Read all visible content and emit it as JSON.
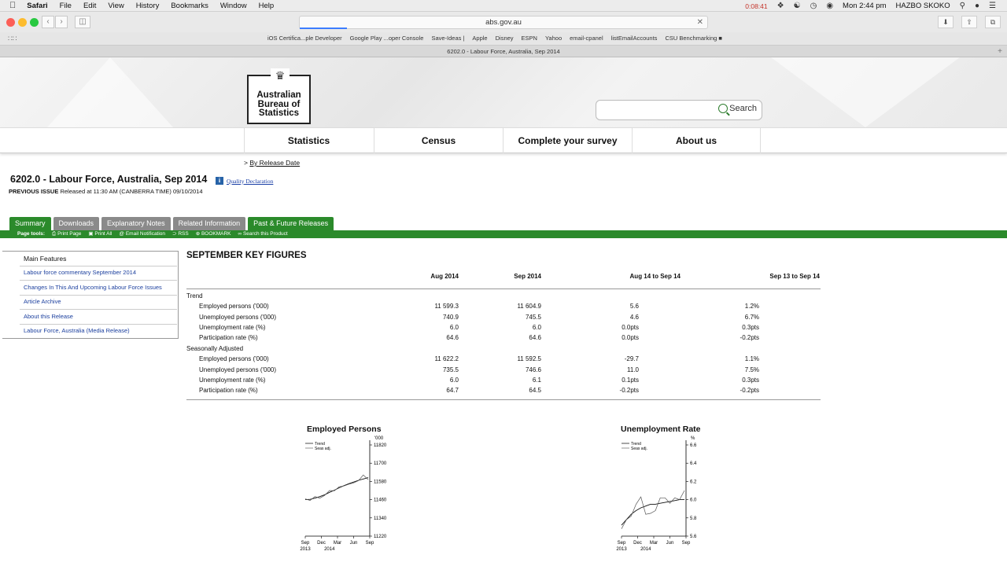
{
  "menubar": {
    "app": "Safari",
    "items": [
      "File",
      "Edit",
      "View",
      "History",
      "Bookmarks",
      "Window",
      "Help"
    ],
    "recording_time": "0:08:41",
    "clock": "Mon 2:44 pm",
    "user": "HAZBO SKOKO"
  },
  "toolbar": {
    "address": "abs.gov.au"
  },
  "favorites": [
    "iOS Certifica...ple Developer",
    "Google Play ...oper Console",
    "Save-Ideas |",
    "Apple",
    "Disney",
    "ESPN",
    "Yahoo",
    "email-cpanel",
    "listEmailAccounts",
    "CSU Benchmarking ■"
  ],
  "tab_title": "6202.0 - Labour Force, Australia, Sep 2014",
  "header": {
    "logo_text": "Australian\nBureau of\nStatistics",
    "search_label": "Search"
  },
  "nav": [
    "Statistics",
    "Census",
    "Complete your survey",
    "About us"
  ],
  "breadcrumb": {
    "prefix": ">",
    "link": "By Release Date"
  },
  "page": {
    "title": "6202.0 - Labour Force, Australia, Sep 2014",
    "quality_link": "Quality Declaration",
    "prev_label": "PREVIOUS ISSUE",
    "prev_text": "Released at 11:30 AM (CANBERRA TIME) 09/10/2014"
  },
  "tabs": [
    "Summary",
    "Downloads",
    "Explanatory Notes",
    "Related Information",
    "Past & Future Releases"
  ],
  "page_tools": {
    "label": "Page tools:",
    "items": [
      "Print Page",
      "Print All",
      "Email Notification",
      "RSS",
      "BOOKMARK",
      "Search this Product"
    ]
  },
  "sidebar": {
    "heading": "Main Features",
    "links": [
      "Labour force commentary September 2014",
      "Changes In This And Upcoming Labour Force Issues",
      "Article Archive",
      "About this Release",
      "Labour Force, Australia (Media Release)"
    ]
  },
  "key_figures": {
    "title": "SEPTEMBER KEY FIGURES",
    "headers": [
      "Aug 2014",
      "Sep 2014",
      "Aug 14 to Sep 14",
      "Sep 13 to Sep 14"
    ],
    "groups": [
      {
        "name": "Trend",
        "rows": [
          {
            "label": "Employed persons ('000)",
            "v": [
              "11 599.3",
              "11 604.9",
              "5.6",
              "1.2%"
            ]
          },
          {
            "label": "Unemployed persons ('000)",
            "v": [
              "740.9",
              "745.5",
              "4.6",
              "6.7%"
            ]
          },
          {
            "label": "Unemployment rate (%)",
            "v": [
              "6.0",
              "6.0",
              "0.0pts",
              "0.3pts"
            ]
          },
          {
            "label": "Participation rate (%)",
            "v": [
              "64.6",
              "64.6",
              "0.0pts",
              "-0.2pts"
            ]
          }
        ]
      },
      {
        "name": "Seasonally Adjusted",
        "rows": [
          {
            "label": "Employed persons ('000)",
            "v": [
              "11 622.2",
              "11 592.5",
              "-29.7",
              "1.1%"
            ]
          },
          {
            "label": "Unemployed persons ('000)",
            "v": [
              "735.5",
              "746.6",
              "11.0",
              "7.5%"
            ]
          },
          {
            "label": "Unemployment rate (%)",
            "v": [
              "6.0",
              "6.1",
              "0.1pts",
              "0.3pts"
            ]
          },
          {
            "label": "Participation rate (%)",
            "v": [
              "64.7",
              "64.5",
              "-0.2pts",
              "-0.2pts"
            ]
          }
        ]
      }
    ]
  },
  "chart_data": [
    {
      "type": "line",
      "title": "Employed Persons",
      "ylabel": "'000",
      "legend": [
        "Trend",
        "Seas adj."
      ],
      "x_ticks": [
        "Sep",
        "Dec",
        "Mar",
        "Jun",
        "Sep"
      ],
      "x_years": [
        "2013",
        "2014"
      ],
      "y_ticks": [
        11220,
        11340,
        11460,
        11580,
        11700,
        11820
      ],
      "ylim": [
        11220,
        11820
      ],
      "series": [
        {
          "name": "Trend",
          "values": [
            11460,
            11462,
            11470,
            11480,
            11492,
            11508,
            11522,
            11538,
            11552,
            11565,
            11576,
            11587,
            11596,
            11605
          ]
        },
        {
          "name": "Seas adj.",
          "values": [
            11465,
            11455,
            11480,
            11470,
            11488,
            11520,
            11518,
            11545,
            11550,
            11562,
            11570,
            11585,
            11622,
            11592
          ]
        }
      ]
    },
    {
      "type": "line",
      "title": "Unemployment Rate",
      "ylabel": "%",
      "legend": [
        "Trend",
        "Seas adj."
      ],
      "x_ticks": [
        "Sep",
        "Dec",
        "Mar",
        "Jun",
        "Sep"
      ],
      "x_years": [
        "2013",
        "2014"
      ],
      "y_ticks": [
        5.6,
        5.8,
        6.0,
        6.2,
        6.4,
        6.6
      ],
      "ylim": [
        5.6,
        6.6
      ],
      "series": [
        {
          "name": "Trend",
          "values": [
            5.72,
            5.78,
            5.84,
            5.88,
            5.91,
            5.93,
            5.95,
            5.95,
            5.96,
            5.97,
            5.98,
            5.99,
            6.0,
            6.0
          ]
        },
        {
          "name": "Seas adj.",
          "values": [
            5.68,
            5.78,
            5.82,
            5.95,
            6.03,
            5.84,
            5.85,
            5.88,
            6.02,
            6.02,
            5.96,
            6.02,
            6.0,
            6.1
          ]
        }
      ]
    }
  ]
}
